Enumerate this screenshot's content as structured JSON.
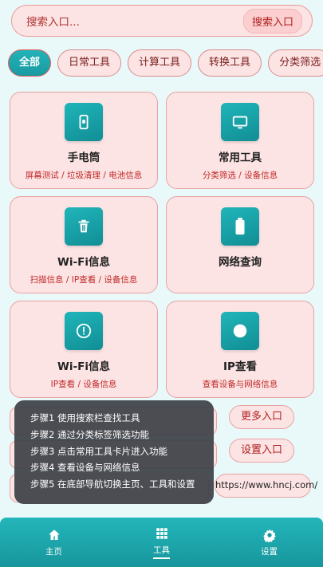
{
  "search": {
    "placeholder": "搜索入口...",
    "button": "搜索入口"
  },
  "chips": [
    "全部",
    "日常工具",
    "计算工具",
    "转换工具",
    "分类筛选"
  ],
  "cards": [
    {
      "icon": "flashlight-icon",
      "title": "手电筒",
      "sub": "屏幕测试 / 垃圾清理 / 电池信息"
    },
    {
      "icon": "monitor-icon",
      "title": "常用工具",
      "sub": "分类筛选 / 设备信息"
    },
    {
      "icon": "trash-icon",
      "title": "Wi-Fi信息",
      "sub": "扫描信息 / IP查看 / 设备信息"
    },
    {
      "icon": "battery-icon",
      "title": "网络查询",
      "sub": ""
    },
    {
      "icon": "info-icon",
      "title": "Wi-Fi信息",
      "sub": "IP查看 / 设备信息"
    },
    {
      "icon": "record-icon",
      "title": "IP查看",
      "sub": "查看设备与网络信息"
    }
  ],
  "links": {
    "more": "更多入口",
    "settings": "设置入口",
    "url": "https://www.hncj.com/"
  },
  "steps": [
    "步骤1  使用搜索栏查找工具",
    "步骤2  通过分类标签筛选功能",
    "步骤3  点击常用工具卡片进入功能",
    "步骤4  查看设备与网络信息",
    "步骤5  在底部导航切换主页、工具和设置"
  ],
  "nav": [
    {
      "icon": "home-icon",
      "label": "主页"
    },
    {
      "icon": "grid-icon",
      "label": "工具"
    },
    {
      "icon": "gear-icon",
      "label": "设置"
    }
  ],
  "colors": {
    "accent": "#1aa3a9",
    "card_bg": "#fde4e4",
    "text_red": "#c02828"
  }
}
